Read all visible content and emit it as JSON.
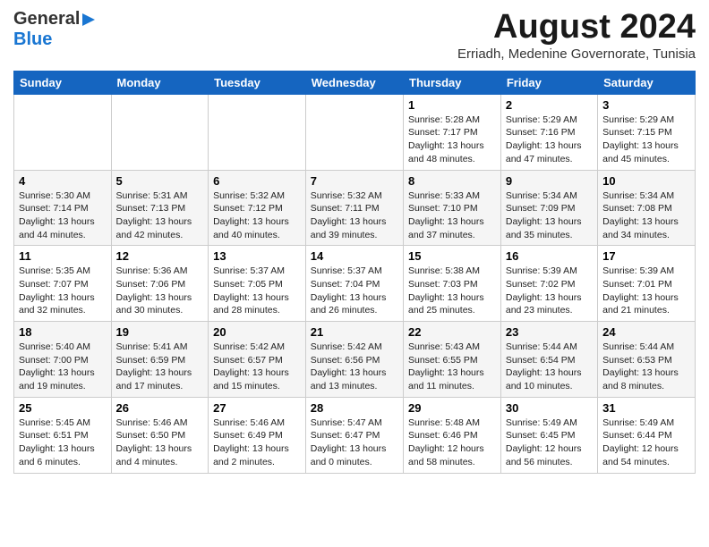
{
  "header": {
    "logo_general": "General",
    "logo_blue": "Blue",
    "title": "August 2024",
    "subtitle": "Erriadh, Medenine Governorate, Tunisia"
  },
  "weekdays": [
    "Sunday",
    "Monday",
    "Tuesday",
    "Wednesday",
    "Thursday",
    "Friday",
    "Saturday"
  ],
  "weeks": [
    [
      {
        "num": "",
        "info": ""
      },
      {
        "num": "",
        "info": ""
      },
      {
        "num": "",
        "info": ""
      },
      {
        "num": "",
        "info": ""
      },
      {
        "num": "1",
        "info": "Sunrise: 5:28 AM\nSunset: 7:17 PM\nDaylight: 13 hours\nand 48 minutes."
      },
      {
        "num": "2",
        "info": "Sunrise: 5:29 AM\nSunset: 7:16 PM\nDaylight: 13 hours\nand 47 minutes."
      },
      {
        "num": "3",
        "info": "Sunrise: 5:29 AM\nSunset: 7:15 PM\nDaylight: 13 hours\nand 45 minutes."
      }
    ],
    [
      {
        "num": "4",
        "info": "Sunrise: 5:30 AM\nSunset: 7:14 PM\nDaylight: 13 hours\nand 44 minutes."
      },
      {
        "num": "5",
        "info": "Sunrise: 5:31 AM\nSunset: 7:13 PM\nDaylight: 13 hours\nand 42 minutes."
      },
      {
        "num": "6",
        "info": "Sunrise: 5:32 AM\nSunset: 7:12 PM\nDaylight: 13 hours\nand 40 minutes."
      },
      {
        "num": "7",
        "info": "Sunrise: 5:32 AM\nSunset: 7:11 PM\nDaylight: 13 hours\nand 39 minutes."
      },
      {
        "num": "8",
        "info": "Sunrise: 5:33 AM\nSunset: 7:10 PM\nDaylight: 13 hours\nand 37 minutes."
      },
      {
        "num": "9",
        "info": "Sunrise: 5:34 AM\nSunset: 7:09 PM\nDaylight: 13 hours\nand 35 minutes."
      },
      {
        "num": "10",
        "info": "Sunrise: 5:34 AM\nSunset: 7:08 PM\nDaylight: 13 hours\nand 34 minutes."
      }
    ],
    [
      {
        "num": "11",
        "info": "Sunrise: 5:35 AM\nSunset: 7:07 PM\nDaylight: 13 hours\nand 32 minutes."
      },
      {
        "num": "12",
        "info": "Sunrise: 5:36 AM\nSunset: 7:06 PM\nDaylight: 13 hours\nand 30 minutes."
      },
      {
        "num": "13",
        "info": "Sunrise: 5:37 AM\nSunset: 7:05 PM\nDaylight: 13 hours\nand 28 minutes."
      },
      {
        "num": "14",
        "info": "Sunrise: 5:37 AM\nSunset: 7:04 PM\nDaylight: 13 hours\nand 26 minutes."
      },
      {
        "num": "15",
        "info": "Sunrise: 5:38 AM\nSunset: 7:03 PM\nDaylight: 13 hours\nand 25 minutes."
      },
      {
        "num": "16",
        "info": "Sunrise: 5:39 AM\nSunset: 7:02 PM\nDaylight: 13 hours\nand 23 minutes."
      },
      {
        "num": "17",
        "info": "Sunrise: 5:39 AM\nSunset: 7:01 PM\nDaylight: 13 hours\nand 21 minutes."
      }
    ],
    [
      {
        "num": "18",
        "info": "Sunrise: 5:40 AM\nSunset: 7:00 PM\nDaylight: 13 hours\nand 19 minutes."
      },
      {
        "num": "19",
        "info": "Sunrise: 5:41 AM\nSunset: 6:59 PM\nDaylight: 13 hours\nand 17 minutes."
      },
      {
        "num": "20",
        "info": "Sunrise: 5:42 AM\nSunset: 6:57 PM\nDaylight: 13 hours\nand 15 minutes."
      },
      {
        "num": "21",
        "info": "Sunrise: 5:42 AM\nSunset: 6:56 PM\nDaylight: 13 hours\nand 13 minutes."
      },
      {
        "num": "22",
        "info": "Sunrise: 5:43 AM\nSunset: 6:55 PM\nDaylight: 13 hours\nand 11 minutes."
      },
      {
        "num": "23",
        "info": "Sunrise: 5:44 AM\nSunset: 6:54 PM\nDaylight: 13 hours\nand 10 minutes."
      },
      {
        "num": "24",
        "info": "Sunrise: 5:44 AM\nSunset: 6:53 PM\nDaylight: 13 hours\nand 8 minutes."
      }
    ],
    [
      {
        "num": "25",
        "info": "Sunrise: 5:45 AM\nSunset: 6:51 PM\nDaylight: 13 hours\nand 6 minutes."
      },
      {
        "num": "26",
        "info": "Sunrise: 5:46 AM\nSunset: 6:50 PM\nDaylight: 13 hours\nand 4 minutes."
      },
      {
        "num": "27",
        "info": "Sunrise: 5:46 AM\nSunset: 6:49 PM\nDaylight: 13 hours\nand 2 minutes."
      },
      {
        "num": "28",
        "info": "Sunrise: 5:47 AM\nSunset: 6:47 PM\nDaylight: 13 hours\nand 0 minutes."
      },
      {
        "num": "29",
        "info": "Sunrise: 5:48 AM\nSunset: 6:46 PM\nDaylight: 12 hours\nand 58 minutes."
      },
      {
        "num": "30",
        "info": "Sunrise: 5:49 AM\nSunset: 6:45 PM\nDaylight: 12 hours\nand 56 minutes."
      },
      {
        "num": "31",
        "info": "Sunrise: 5:49 AM\nSunset: 6:44 PM\nDaylight: 12 hours\nand 54 minutes."
      }
    ]
  ]
}
